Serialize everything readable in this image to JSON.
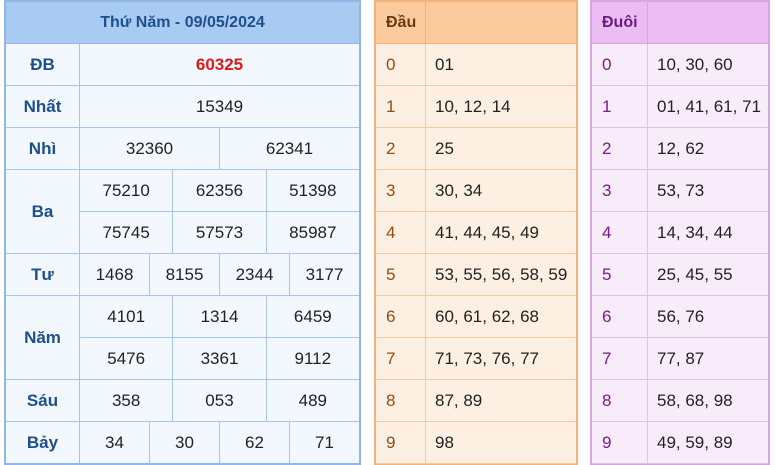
{
  "results": {
    "title": "Thứ Năm - 09/05/2024",
    "prizes": [
      {
        "label": "ĐB",
        "lines": [
          [
            "60325"
          ]
        ],
        "special": true
      },
      {
        "label": "Nhất",
        "lines": [
          [
            "15349"
          ]
        ]
      },
      {
        "label": "Nhì",
        "lines": [
          [
            "32360",
            "62341"
          ]
        ]
      },
      {
        "label": "Ba",
        "lines": [
          [
            "75210",
            "62356",
            "51398"
          ],
          [
            "75745",
            "57573",
            "85987"
          ]
        ]
      },
      {
        "label": "Tư",
        "lines": [
          [
            "1468",
            "8155",
            "2344",
            "3177"
          ]
        ]
      },
      {
        "label": "Năm",
        "lines": [
          [
            "4101",
            "1314",
            "6459"
          ],
          [
            "5476",
            "3361",
            "9112"
          ]
        ]
      },
      {
        "label": "Sáu",
        "lines": [
          [
            "358",
            "053",
            "489"
          ]
        ]
      },
      {
        "label": "Bảy",
        "lines": [
          [
            "34",
            "30",
            "62",
            "71"
          ]
        ]
      }
    ]
  },
  "dau": {
    "title": "Đầu",
    "rows": [
      {
        "k": "0",
        "v": "01"
      },
      {
        "k": "1",
        "v": "10, 12, 14"
      },
      {
        "k": "2",
        "v": "25"
      },
      {
        "k": "3",
        "v": "30, 34"
      },
      {
        "k": "4",
        "v": "41, 44, 45, 49"
      },
      {
        "k": "5",
        "v": "53, 55, 56, 58, 59"
      },
      {
        "k": "6",
        "v": "60, 61, 62, 68"
      },
      {
        "k": "7",
        "v": "71, 73, 76, 77"
      },
      {
        "k": "8",
        "v": "87, 89"
      },
      {
        "k": "9",
        "v": "98"
      }
    ]
  },
  "duoi": {
    "title": "Đuôi",
    "rows": [
      {
        "k": "0",
        "v": "10, 30, 60"
      },
      {
        "k": "1",
        "v": "01, 41, 61, 71"
      },
      {
        "k": "2",
        "v": "12, 62"
      },
      {
        "k": "3",
        "v": "53, 73"
      },
      {
        "k": "4",
        "v": "14, 34, 44"
      },
      {
        "k": "5",
        "v": "25, 45, 55"
      },
      {
        "k": "6",
        "v": "56, 76"
      },
      {
        "k": "7",
        "v": "77, 87"
      },
      {
        "k": "8",
        "v": "58, 68, 98"
      },
      {
        "k": "9",
        "v": "49, 59, 89"
      }
    ]
  },
  "colors": {
    "special_prize": "#e01818",
    "label_blue": "#1e4f8c",
    "dau_accent": "#fccb9d",
    "duoi_accent": "#ebbcf3"
  }
}
